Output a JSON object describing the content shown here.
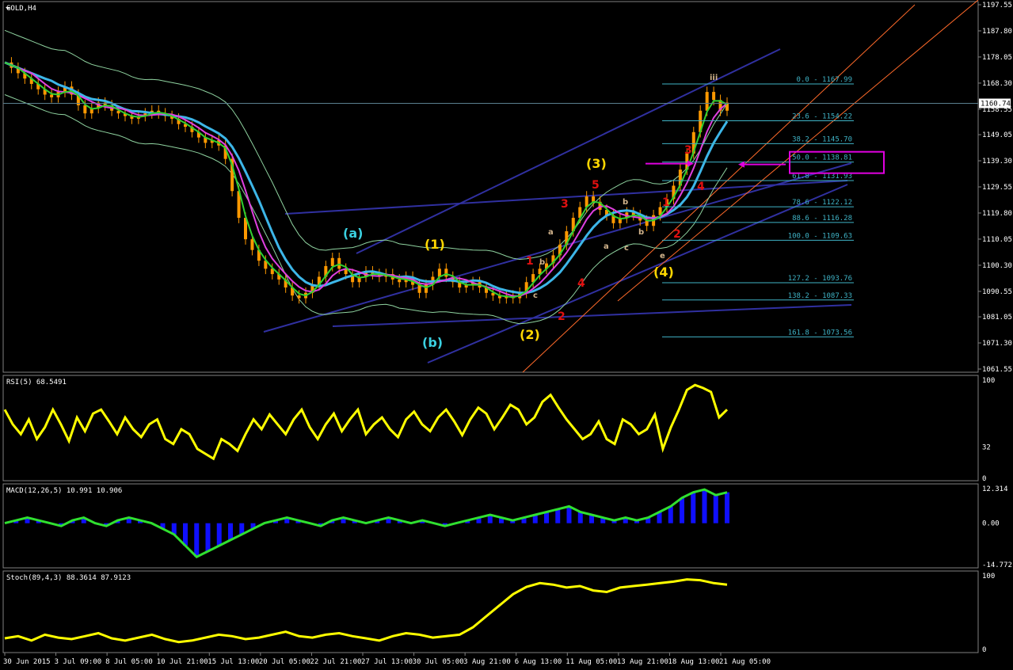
{
  "chart_data": {
    "type": "candlestick",
    "symbol_label": "GOLD,H4",
    "price_axis": {
      "range": [
        1061.55,
        1197.55
      ],
      "ticks": [
        "1197.55",
        "1187.80",
        "1178.05",
        "1168.30",
        "1158.55",
        "1149.05",
        "1139.30",
        "1129.55",
        "1119.80",
        "1110.05",
        "1100.30",
        "1090.55",
        "1081.05",
        "1071.30",
        "1061.55"
      ],
      "current_price": "1160.74"
    },
    "time_axis": [
      "30 Jun 2015",
      "3 Jul 09:00",
      "8 Jul 05:00",
      "10 Jul 21:00",
      "15 Jul 13:00",
      "20 Jul 05:00",
      "22 Jul 21:00",
      "27 Jul 13:00",
      "30 Jul 05:00",
      "3 Aug 21:00",
      "6 Aug 13:00",
      "11 Aug 05:00",
      "13 Aug 21:00",
      "18 Aug 13:00",
      "21 Aug 05:00"
    ],
    "price_series": [
      1176,
      1174,
      1172,
      1170,
      1168,
      1166,
      1164,
      1163,
      1165,
      1167,
      1164,
      1160,
      1157,
      1159,
      1161,
      1160,
      1158,
      1157,
      1156,
      1155,
      1156,
      1157,
      1158,
      1157,
      1156,
      1155,
      1153,
      1152,
      1150,
      1148,
      1146,
      1147,
      1145,
      1140,
      1128,
      1118,
      1110,
      1106,
      1102,
      1099,
      1097,
      1095,
      1092,
      1089,
      1088,
      1090,
      1093,
      1096,
      1100,
      1103,
      1099,
      1097,
      1094,
      1096,
      1098,
      1097,
      1096,
      1097,
      1095,
      1094,
      1096,
      1093,
      1090,
      1093,
      1096,
      1099,
      1096,
      1094,
      1092,
      1093,
      1094,
      1092,
      1090,
      1089,
      1088,
      1089,
      1088,
      1090,
      1094,
      1097,
      1099,
      1101,
      1104,
      1108,
      1113,
      1118,
      1122,
      1126,
      1124,
      1121,
      1119,
      1116,
      1118,
      1120,
      1119,
      1117,
      1115,
      1119,
      1122,
      1125,
      1130,
      1136,
      1142,
      1150,
      1158,
      1165,
      1162,
      1158,
      1161
    ],
    "fibonacci_levels": [
      {
        "label": "0.0 - 1167.99",
        "price": 1167.99
      },
      {
        "label": "23.6 - 1154.22",
        "price": 1154.22
      },
      {
        "label": "38.2 - 1145.70",
        "price": 1145.7
      },
      {
        "label": "50.0 - 1138.81",
        "price": 1138.81
      },
      {
        "label": "61.8 - 1131.93",
        "price": 1131.93
      },
      {
        "label": "78.6 - 1122.12",
        "price": 1122.12
      },
      {
        "label": "88.6 - 1116.28",
        "price": 1116.28
      },
      {
        "label": "100.0 - 1109.63",
        "price": 1109.63
      },
      {
        "label": "127.2 - 1093.76",
        "price": 1093.76
      },
      {
        "label": "138.2 - 1087.33",
        "price": 1087.33
      },
      {
        "label": "161.8 - 1073.56",
        "price": 1073.56
      }
    ],
    "wave_labels": [
      {
        "text": "(a)",
        "color": "#3ad0e0"
      },
      {
        "text": "(b)",
        "color": "#3ad0e0"
      },
      {
        "text": "(1)",
        "color": "#ffd700"
      },
      {
        "text": "(2)",
        "color": "#ffd700"
      },
      {
        "text": "(3)",
        "color": "#ffd700"
      },
      {
        "text": "(4)",
        "color": "#ffd700"
      },
      {
        "text": "1",
        "color": "#e01010"
      },
      {
        "text": "2",
        "color": "#e01010"
      },
      {
        "text": "3",
        "color": "#e01010"
      },
      {
        "text": "4",
        "color": "#e01010"
      },
      {
        "text": "5",
        "color": "#e01010"
      },
      {
        "text": "1",
        "color": "#e01010"
      },
      {
        "text": "2",
        "color": "#e01010"
      },
      {
        "text": "3",
        "color": "#e01010"
      },
      {
        "text": "4",
        "color": "#e01010"
      },
      {
        "text": "a",
        "color": "#d2b48c"
      },
      {
        "text": "b",
        "color": "#d2b48c"
      },
      {
        "text": "c",
        "color": "#d2b48c"
      },
      {
        "text": "b",
        "color": "#d2b48c"
      },
      {
        "text": "a",
        "color": "#d2b48c"
      },
      {
        "text": "b",
        "color": "#d2b48c"
      },
      {
        "text": "c",
        "color": "#d2b48c"
      },
      {
        "text": "e",
        "color": "#d2b48c"
      },
      {
        "text": "iii",
        "color": "#d2b48c"
      }
    ],
    "rsi": {
      "label": "RSI(5) 68.5491",
      "ticks": [
        "100",
        "32",
        "0"
      ],
      "series": [
        70,
        55,
        45,
        60,
        40,
        52,
        70,
        55,
        38,
        62,
        48,
        66,
        70,
        58,
        45,
        62,
        50,
        42,
        55,
        60,
        40,
        35,
        50,
        45,
        30,
        25,
        20,
        40,
        35,
        28,
        45,
        60,
        50,
        65,
        55,
        45,
        60,
        70,
        52,
        40,
        55,
        66,
        48,
        60,
        70,
        45,
        55,
        62,
        50,
        42,
        60,
        68,
        55,
        48,
        62,
        70,
        58,
        44,
        60,
        72,
        66,
        50,
        62,
        75,
        70,
        55,
        62,
        78,
        85,
        72,
        60,
        50,
        40,
        45,
        58,
        40,
        35,
        60,
        55,
        45,
        50,
        65,
        30,
        52,
        70,
        90,
        95,
        92,
        88,
        62,
        70
      ]
    },
    "macd": {
      "label": "MACD(12,26,5) 10.991 10.906",
      "ticks": [
        "12.314",
        "0.00",
        "-14.772"
      ],
      "series": [
        0,
        1,
        2,
        1,
        0,
        -1,
        1,
        2,
        0,
        -1,
        1,
        2,
        1,
        0,
        -2,
        -4,
        -8,
        -12,
        -10,
        -8,
        -6,
        -4,
        -2,
        0,
        1,
        2,
        1,
        0,
        -1,
        1,
        2,
        1,
        0,
        1,
        2,
        1,
        0,
        1,
        0,
        -1,
        0,
        1,
        2,
        3,
        2,
        1,
        2,
        3,
        4,
        5,
        6,
        4,
        3,
        2,
        1,
        2,
        1,
        2,
        4,
        6,
        9,
        11,
        12,
        10,
        11
      ]
    },
    "stoch": {
      "label": "Stoch(89,4,3) 88.3614 87.9123",
      "ticks": [
        "100",
        "0"
      ],
      "series": [
        15,
        18,
        12,
        20,
        16,
        14,
        18,
        22,
        15,
        12,
        16,
        20,
        14,
        10,
        12,
        16,
        20,
        18,
        14,
        16,
        20,
        24,
        18,
        16,
        20,
        22,
        18,
        15,
        12,
        18,
        22,
        20,
        16,
        18,
        20,
        30,
        45,
        60,
        75,
        85,
        90,
        88,
        84,
        86,
        80,
        78,
        84,
        86,
        88,
        90,
        92,
        95,
        94,
        90,
        88
      ]
    }
  },
  "colors": {
    "background": "#000000",
    "candle_up": "#ff9900",
    "candle_down": "#ff9900",
    "ma_slow": "#3db6e8",
    "ma_mid": "#e040e0",
    "ma_fast": "#30d030",
    "bands": "#8fd3a0",
    "trend_lines": "#3030a0",
    "fib_color": "#3fb3c6",
    "highlight_box": "#e000e0",
    "rsi_line": "#ffff00",
    "macd_line": "#30e030",
    "macd_hist": "#1010ff"
  }
}
